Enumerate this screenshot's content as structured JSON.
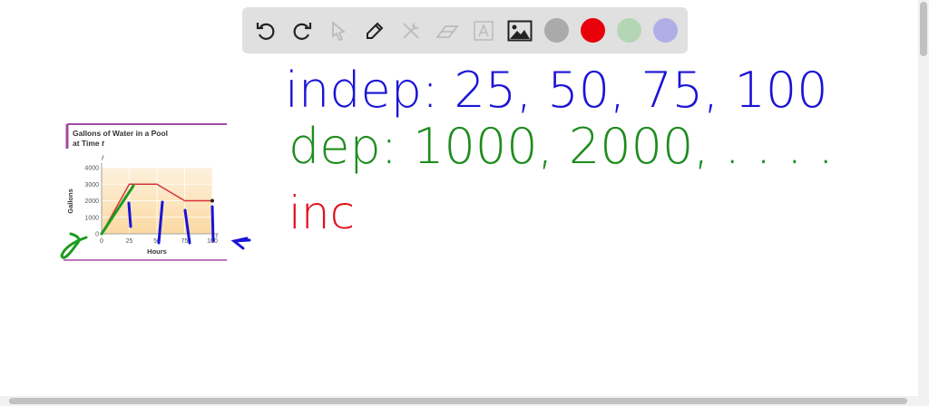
{
  "toolbar": {
    "tools": [
      "undo-icon",
      "redo-icon",
      "select-icon",
      "pen-icon",
      "tools-icon",
      "eraser-icon",
      "text-icon",
      "image-icon"
    ],
    "colors": [
      "#aaaaaa",
      "#e8000b",
      "#b5d6b5",
      "#b0aee6"
    ]
  },
  "notes": {
    "line1": "indep: 25, 50, 75, 100",
    "line2": "dep: 1000, 2000, . . . .",
    "line3": "inc",
    "colors": {
      "line1": "#1a14d6",
      "line2": "#1e8c1e",
      "line3": "#e0101a"
    }
  },
  "chart_data": {
    "type": "line",
    "title": "Gallons of Water in a Pool at Time t",
    "xlabel": "Hours",
    "ylabel": "Gallons",
    "x_axis_var": "t",
    "y_axis_var": "f",
    "x": [
      0,
      25,
      50,
      75,
      100
    ],
    "values": [
      0,
      3000,
      3000,
      2000,
      2000
    ],
    "xticks": [
      "0",
      "25",
      "50",
      "75",
      "100"
    ],
    "yticks": [
      "0",
      "1000",
      "2000",
      "3000",
      "4000"
    ],
    "xlim": [
      0,
      100
    ],
    "ylim": [
      0,
      4000
    ]
  }
}
